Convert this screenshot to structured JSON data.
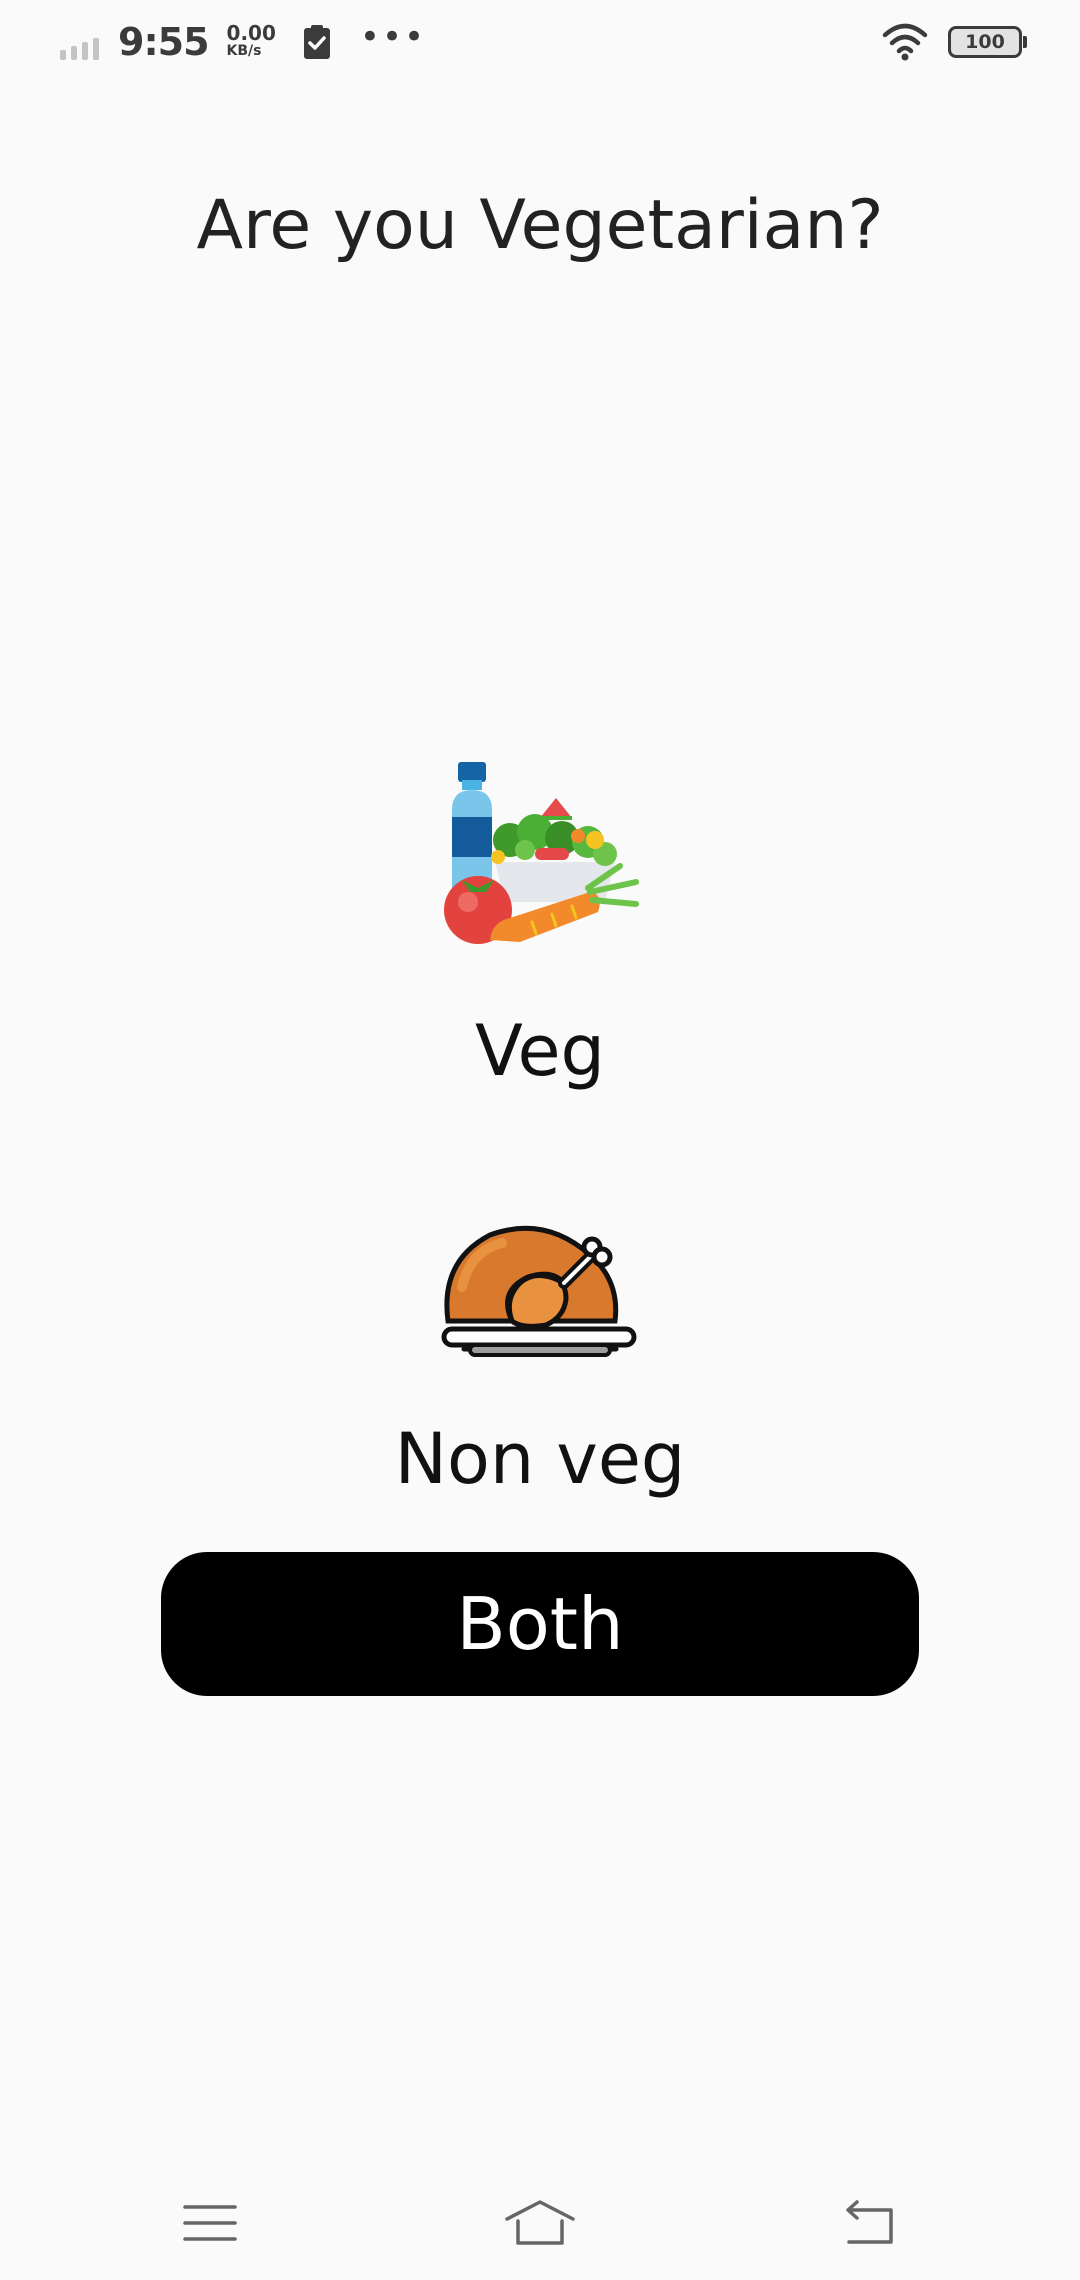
{
  "status_bar": {
    "time": "9:55",
    "net_speed_value": "0.00",
    "net_speed_unit": "KB/s",
    "more": "•••",
    "battery_level": "100",
    "icons": [
      "signal-icon",
      "clipboard-check-icon",
      "more-dots-icon",
      "wifi-icon",
      "battery-icon"
    ]
  },
  "screen": {
    "question": "Are you Vegetarian?",
    "options": [
      {
        "label": "Veg",
        "icon": "vegetables-icon"
      },
      {
        "label": "Non veg",
        "icon": "roast-chicken-icon"
      }
    ],
    "both_button": {
      "label": "Both"
    }
  },
  "nav_bar": {
    "items": [
      "menu-icon",
      "home-icon",
      "back-icon"
    ]
  },
  "colors": {
    "background": "#fafafa",
    "button_bg": "#000000",
    "button_text": "#ffffff",
    "text_primary": "#222222"
  }
}
